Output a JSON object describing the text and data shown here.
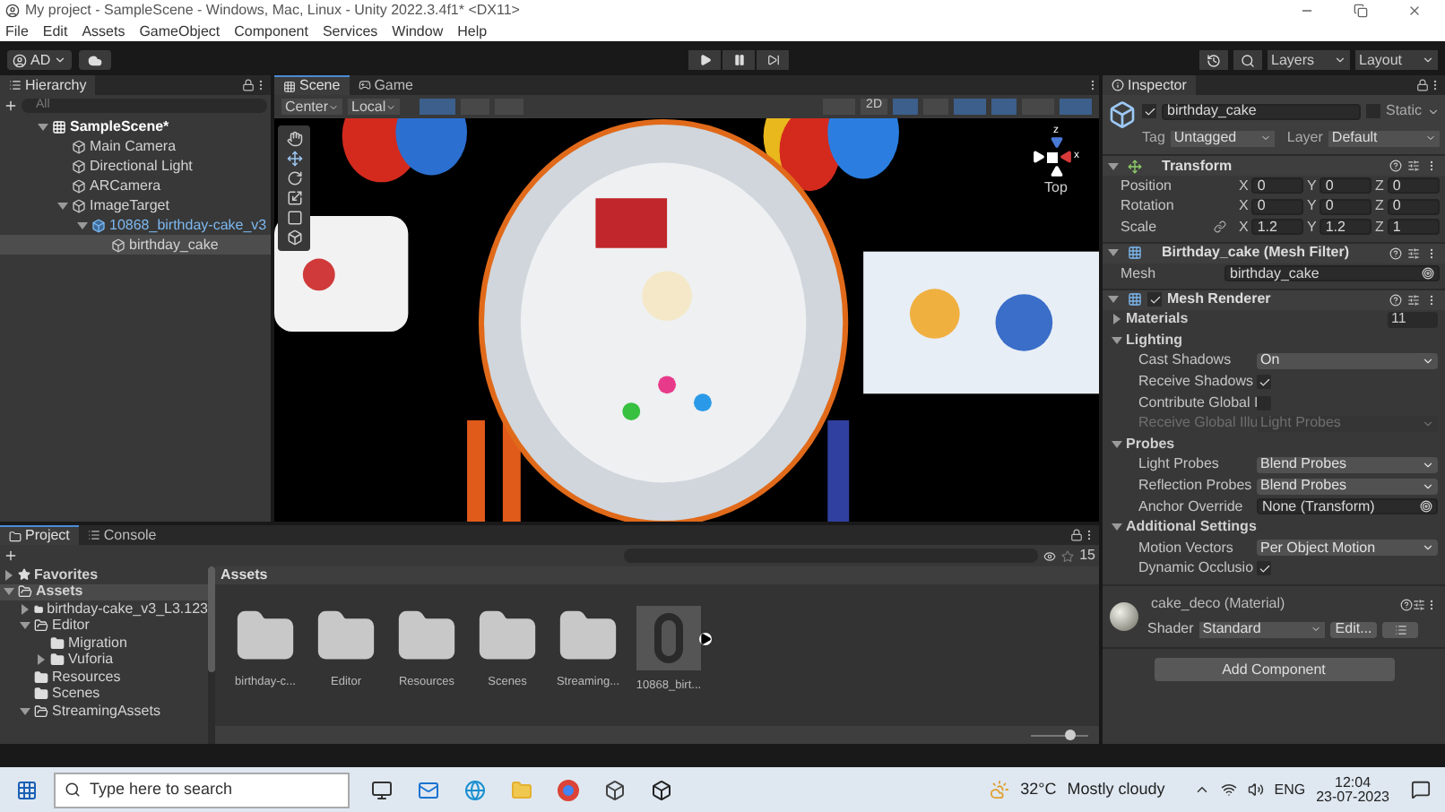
{
  "window": {
    "title": "My project - SampleScene - Windows, Mac, Linux - Unity 2022.3.4f1* <DX11>"
  },
  "menu": [
    "File",
    "Edit",
    "Assets",
    "GameObject",
    "Component",
    "Services",
    "Window",
    "Help"
  ],
  "toolbar": {
    "account": "AD",
    "layers": "Layers",
    "layout": "Layout"
  },
  "hierarchy": {
    "title": "Hierarchy",
    "placeholder": "All",
    "tree": [
      {
        "label": "SampleScene*",
        "kind": "scene",
        "expanded": true,
        "selected": false,
        "children": [
          {
            "label": "Main Camera",
            "kind": "object",
            "selected": false
          },
          {
            "label": "Directional Light",
            "kind": "object",
            "selected": false
          },
          {
            "label": "ARCamera",
            "kind": "object",
            "selected": false
          },
          {
            "label": "ImageTarget",
            "kind": "object",
            "expanded": true,
            "selected": false,
            "children": [
              {
                "label": "10868_birthday-cake_v3",
                "kind": "prefab",
                "expanded": true,
                "selected": false,
                "children": [
                  {
                    "label": "birthday_cake",
                    "kind": "object",
                    "selected": true
                  }
                ]
              }
            ]
          }
        ]
      }
    ]
  },
  "scene": {
    "tabs": [
      {
        "label": "Scene",
        "selected": true
      },
      {
        "label": "Game",
        "selected": false
      }
    ],
    "pivot": "Center",
    "space": "Local",
    "mode": "2D",
    "gizmo": {
      "z": "z",
      "x": "x",
      "view": "Top"
    }
  },
  "inspector": {
    "title": "Inspector",
    "name": "birthday_cake",
    "active": true,
    "static": {
      "label": "Static",
      "checked": false
    },
    "tag": {
      "label": "Tag",
      "value": "Untagged"
    },
    "layer": {
      "label": "Layer",
      "value": "Default"
    },
    "transform": {
      "title": "Transform",
      "expanded": true,
      "rows": [
        {
          "label": "Position",
          "values": [
            {
              "axis": "X",
              "value": "0"
            },
            {
              "axis": "Y",
              "value": "0"
            },
            {
              "axis": "Z",
              "value": "0"
            }
          ]
        },
        {
          "label": "Rotation",
          "values": [
            {
              "axis": "X",
              "value": "0"
            },
            {
              "axis": "Y",
              "value": "0"
            },
            {
              "axis": "Z",
              "value": "0"
            }
          ]
        },
        {
          "label": "Scale",
          "linked": true,
          "values": [
            {
              "axis": "X",
              "value": "1.2"
            },
            {
              "axis": "Y",
              "value": "1.2"
            },
            {
              "axis": "Z",
              "value": "1"
            }
          ]
        }
      ]
    },
    "mesh_filter": {
      "title": "Birthday_cake (Mesh Filter)",
      "expanded": true,
      "label": "Mesh",
      "value": "birthday_cake"
    },
    "mesh_renderer": {
      "title": "Mesh Renderer",
      "expanded": true,
      "enabled": true,
      "rows": [
        {
          "kind": "foldout",
          "label": "Materials",
          "expanded": false,
          "value": "11"
        },
        {
          "kind": "foldout",
          "label": "Lighting",
          "expanded": true
        },
        {
          "kind": "dropdown",
          "label": "Cast Shadows",
          "value": "On",
          "disabled": false
        },
        {
          "kind": "toggle",
          "label": "Receive Shadows",
          "checked": true
        },
        {
          "kind": "toggle",
          "label": "Contribute Global I",
          "checked": false
        },
        {
          "kind": "dropdown",
          "label": "Receive Global Illu",
          "value": "Light Probes",
          "disabled": true
        },
        {
          "kind": "foldout",
          "label": "Probes",
          "expanded": true
        },
        {
          "kind": "dropdown",
          "label": "Light Probes",
          "value": "Blend Probes",
          "disabled": false
        },
        {
          "kind": "dropdown",
          "label": "Reflection Probes",
          "value": "Blend Probes",
          "disabled": false
        },
        {
          "kind": "object",
          "label": "Anchor Override",
          "value": "None (Transform)"
        },
        {
          "kind": "foldout",
          "label": "Additional Settings",
          "expanded": true
        },
        {
          "kind": "dropdown",
          "label": "Motion Vectors",
          "value": "Per Object Motion",
          "disabled": false
        },
        {
          "kind": "toggle",
          "label": "Dynamic Occlusio",
          "checked": true
        }
      ]
    },
    "material": {
      "name": "cake_deco (Material)",
      "shader_label": "Shader",
      "shader": "Standard",
      "edit": "Edit..."
    },
    "add_component": "Add Component"
  },
  "project": {
    "tabs": [
      {
        "label": "Project",
        "selected": true
      },
      {
        "label": "Console",
        "selected": false
      }
    ],
    "count": "15",
    "tree": [
      {
        "label": "Favorites",
        "kind": "favorites",
        "expanded": false,
        "selected": false
      },
      {
        "label": "Assets",
        "kind": "folder",
        "expanded": true,
        "selected": true,
        "children": [
          {
            "label": "birthday-cake_v3_L3.123",
            "kind": "folder",
            "expanded": false,
            "selected": false
          },
          {
            "label": "Editor",
            "kind": "folder",
            "expanded": true,
            "selected": false,
            "children": [
              {
                "label": "Migration",
                "kind": "folder",
                "selected": false
              },
              {
                "label": "Vuforia",
                "kind": "folder",
                "expanded": false,
                "selected": false
              }
            ]
          },
          {
            "label": "Resources",
            "kind": "folder",
            "selected": false
          },
          {
            "label": "Scenes",
            "kind": "folder",
            "selected": false
          },
          {
            "label": "StreamingAssets",
            "kind": "folder",
            "expanded": true,
            "selected": false
          }
        ]
      }
    ],
    "breadcrumb": "Assets",
    "assets": [
      {
        "label": "birthday-c...",
        "kind": "folder"
      },
      {
        "label": "Editor",
        "kind": "folder"
      },
      {
        "label": "Resources",
        "kind": "folder"
      },
      {
        "label": "Scenes",
        "kind": "folder"
      },
      {
        "label": "Streaming...",
        "kind": "folder"
      },
      {
        "label": "10868_birt...",
        "kind": "model"
      }
    ],
    "zoom": {
      "level": 0.7
    }
  },
  "taskbar": {
    "placeholder": "Type here to search",
    "temperature": "32°C",
    "weather": "Mostly cloudy",
    "language": "ENG",
    "time": "12:04",
    "date": "23-07-2023"
  }
}
